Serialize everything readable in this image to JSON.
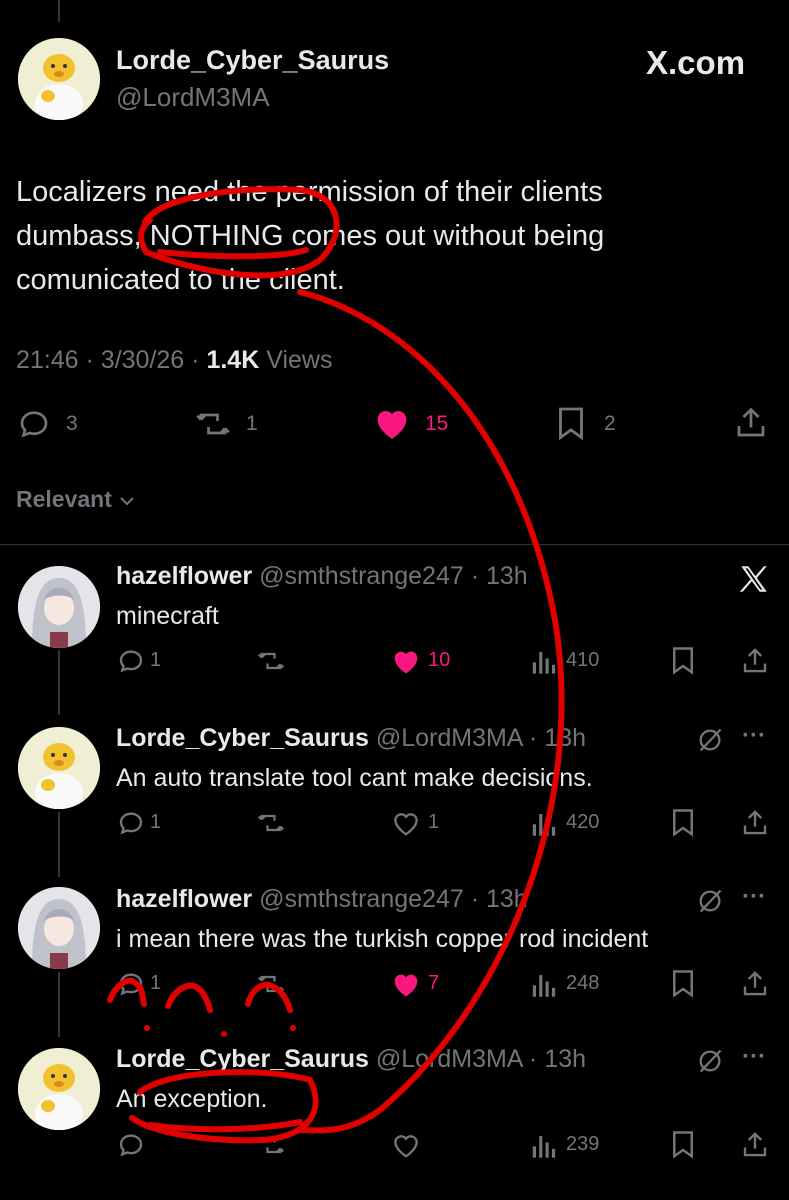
{
  "main_post": {
    "display_name": "Lorde_Cyber_Saurus",
    "handle": "@LordM3MA",
    "brand": "X.com",
    "text_lines": [
      "Localizers need the permission of their clients",
      "dumbass, NOTHING comes out without being",
      "comunicated to the client."
    ],
    "time": "21:46",
    "date": "3/30/26",
    "views_count": "1.4K",
    "views_label": "Views",
    "replies": "3",
    "reposts": "1",
    "likes": "15",
    "bookmarks": "2"
  },
  "sort_label": "Relevant",
  "replies": [
    {
      "display_name": "hazelflower",
      "handle": "@smthstrange247",
      "time": "13h",
      "text": "minecraft",
      "replies": "1",
      "likes": "10",
      "views": "410",
      "liked": true
    },
    {
      "display_name": "Lorde_Cyber_Saurus",
      "handle": "@LordM3MA",
      "time": "13h",
      "text": "An auto translate tool cant make decisions.",
      "replies": "1",
      "likes": "1",
      "views": "420",
      "liked": false
    },
    {
      "display_name": "hazelflower",
      "handle": "@smthstrange247",
      "time": "13h",
      "text": "i mean there was the turkish copper rod incident",
      "replies": "1",
      "likes": "7",
      "views": "248",
      "liked": true
    },
    {
      "display_name": "Lorde_Cyber_Saurus",
      "handle": "@LordM3MA",
      "time": "13h",
      "text": "An exception.",
      "replies": "",
      "likes": "",
      "views": "239",
      "liked": false
    }
  ],
  "colors": {
    "background": "#000000",
    "text": "#e7e9ea",
    "muted": "#71767b",
    "like_pink": "#f91880",
    "annotation_red": "#e00000"
  },
  "icons": [
    "reply-icon",
    "repost-icon",
    "like-icon",
    "bookmark-icon",
    "share-icon",
    "views-icon",
    "x-logo-icon",
    "grok-icon",
    "more-icon",
    "chevron-down-icon"
  ]
}
